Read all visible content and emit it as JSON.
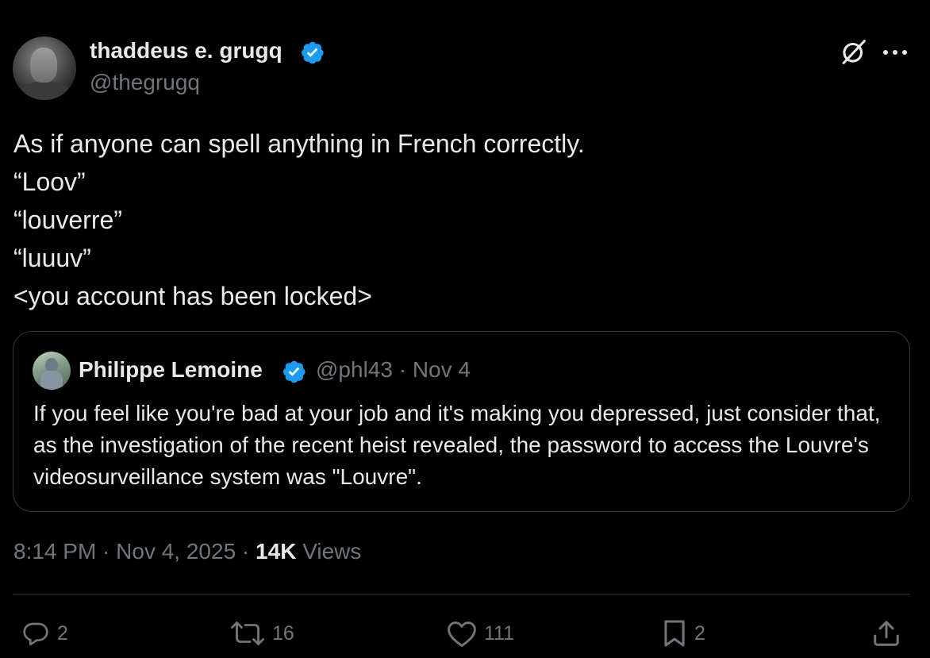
{
  "author": {
    "name": "thaddeus e. grugq",
    "handle": "@thegrugq",
    "verified": true
  },
  "tweet": {
    "lines": [
      "As if anyone can spell anything in French correctly.",
      "“Loov”",
      "“louverre”",
      "“luuuv”",
      "<you account has been locked>"
    ]
  },
  "quote": {
    "name": "Philippe Lemoine",
    "handle_date": "@phl43 · Nov 4",
    "verified": true,
    "text": "If you feel like you're bad at your job and it's making you depressed, just consider that, as the investigation of the recent heist revealed, the password to access the Louvre's videosurveillance system was \"Louvre\"."
  },
  "meta": {
    "time_date": "8:14 PM · Nov 4, 2025 · ",
    "views_count": "14K",
    "views_label": " Views"
  },
  "actions": {
    "reply_count": "2",
    "retweet_count": "16",
    "like_count": "111",
    "bookmark_count": "2"
  },
  "colors": {
    "background": "#000000",
    "text_primary": "#e7e9ea",
    "text_secondary": "#71767b",
    "verified_blue": "#1d9bf0",
    "border": "#333639"
  },
  "icons": {
    "verified": "verified-badge-icon",
    "grok": "grok-icon",
    "more": "more-icon",
    "reply": "reply-icon",
    "retweet": "retweet-icon",
    "like": "heart-icon",
    "bookmark": "bookmark-icon",
    "share": "share-icon"
  }
}
